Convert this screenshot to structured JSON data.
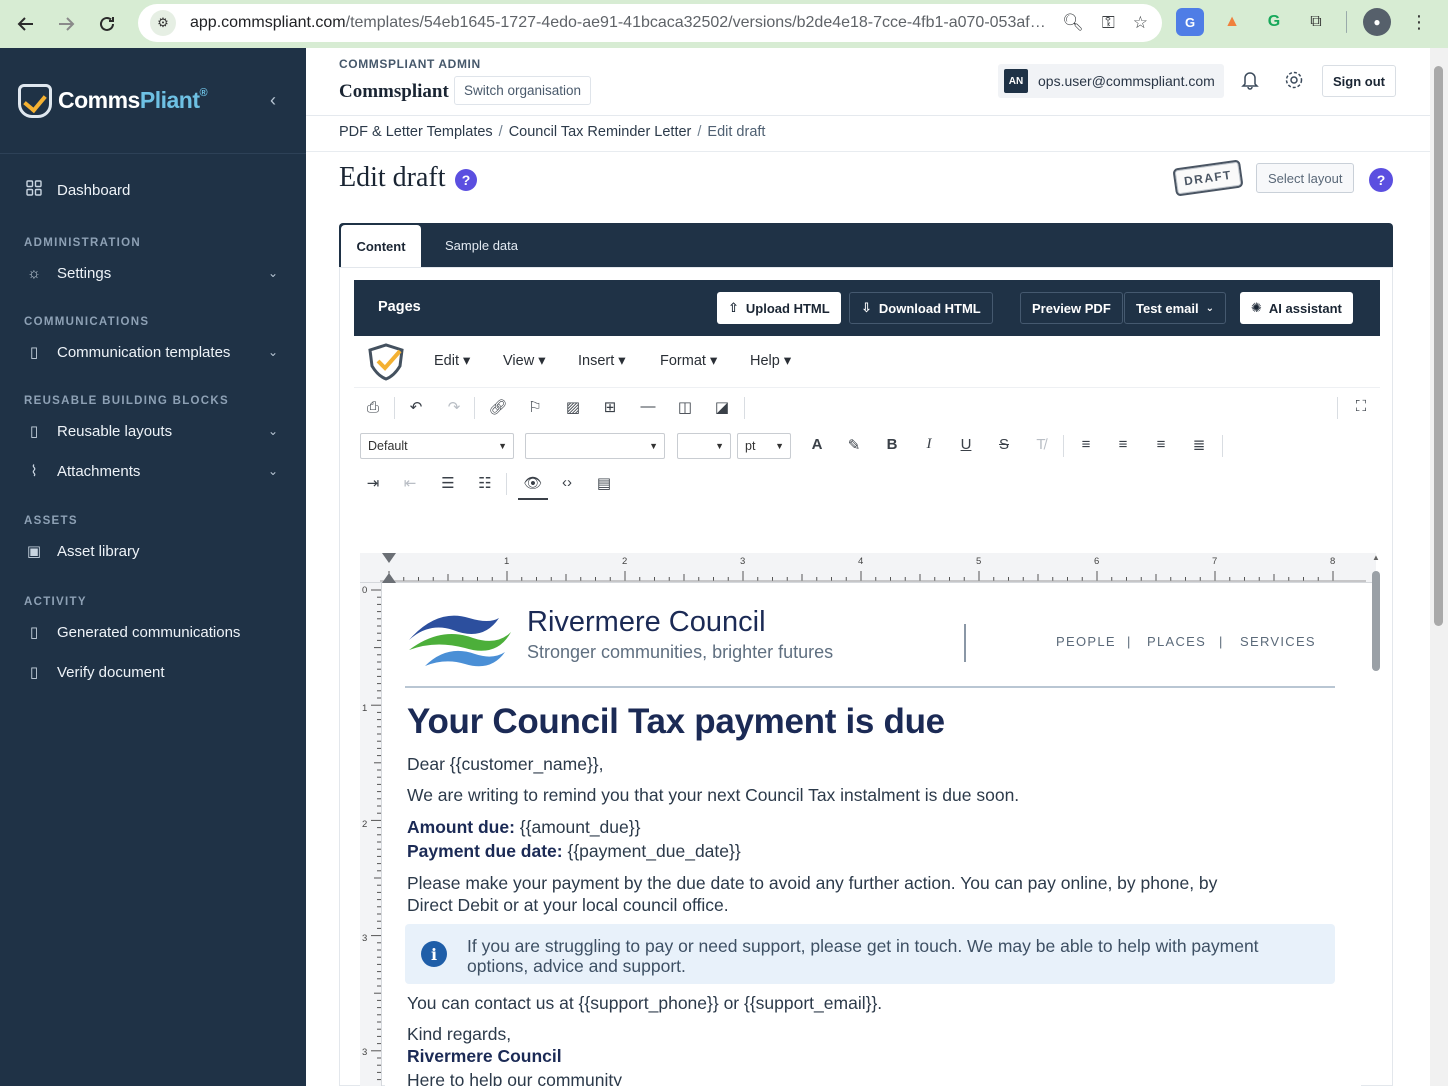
{
  "browser": {
    "url_host": "app.commspliant.com",
    "url_path": "/templates/54eb1645-1727-4edo-ae91-41bcaca32502/versions/b2de4e18-7cce-4fb1-a070-053af…",
    "back_icon": "arrow-left-icon",
    "forward_icon": "arrow-right-icon",
    "reload_icon": "reload-icon"
  },
  "sidebar": {
    "logo_main": "Comms",
    "logo_accent": "Pliant",
    "logo_mark": "®",
    "dashboard": "Dashboard",
    "sections": {
      "administration": "ADMINISTRATION",
      "communications": "COMMUNICATIONS",
      "building_blocks": "REUSABLE BUILDING BLOCKS",
      "assets": "ASSETS",
      "activity": "ACTIVITY"
    },
    "items": {
      "settings": "Settings",
      "communication_templates": "Communication templates",
      "reusable_layouts": "Reusable layouts",
      "attachments": "Attachments",
      "asset_library": "Asset library",
      "generated_communications": "Generated communications",
      "verify_document": "Verify document"
    }
  },
  "header": {
    "org_label": "COMMSPLIANT ADMIN",
    "org_name": "Commspliant",
    "switch_org": "Switch organisation",
    "avatar": "AN",
    "user_email": "ops.user@commspliant.com",
    "sign_out": "Sign out"
  },
  "breadcrumb": {
    "c1": "PDF & Letter Templates",
    "c2": "Council Tax Reminder Letter",
    "c3": "Edit draft",
    "sep": "/"
  },
  "page": {
    "title": "Edit draft",
    "help": "?",
    "draft_badge": "DRAFT",
    "select_layout": "Select layout"
  },
  "tabs": {
    "content": "Content",
    "sample_data": "Sample data"
  },
  "pages_bar": {
    "title": "Pages",
    "upload_html": "Upload HTML",
    "download_html": "Download HTML",
    "preview_pdf": "Preview PDF",
    "test_email": "Test email",
    "ai_assistant": "AI assistant"
  },
  "menubar": {
    "edit": "Edit",
    "view": "View",
    "insert": "Insert",
    "format": "Format",
    "help": "Help"
  },
  "toolbar": {
    "block_format": "Default",
    "font_family": "",
    "font_size": "",
    "unit": "pt"
  },
  "ruler": {
    "h_ticks": [
      "1",
      "2",
      "3",
      "4",
      "5",
      "6",
      "7",
      "8"
    ],
    "v_ticks": [
      "0",
      "1",
      "2",
      "3",
      "3"
    ]
  },
  "document": {
    "org_name": "Rivermere Council",
    "tagline": "Stronger communities, brighter futures",
    "nav_people": "PEOPLE",
    "nav_places": "PLACES",
    "nav_services": "SERVICES",
    "nav_sep": "|",
    "heading": "Your Council Tax payment is due",
    "greeting": "Dear {{customer_name}},",
    "intro": "We are writing to remind you that your next Council Tax instalment is due soon.",
    "amount_label": "Amount due:",
    "amount_value": " {{amount_due}}",
    "date_label": "Payment due date:",
    "date_value": " {{payment_due_date}}",
    "payment_line1": "Please make your payment by the due date to avoid any further action. You can pay online, by phone, by",
    "payment_line2": "Direct Debit or at your local council office.",
    "callout": "If you are struggling to pay or need support, please get in touch. We may be able to help with payment options, advice and support.",
    "contact": "You can contact us at {{support_phone}} or {{support_email}}.",
    "regards": "Kind regards,",
    "signoff_org": "Rivermere Council",
    "signoff_tag": "Here to help our community"
  },
  "colors": {
    "sidebar_bg": "#1f3246",
    "accent_purple": "#5b4fe0",
    "council_navy": "#1b2a55",
    "callout_bg": "#e8f1fa"
  }
}
